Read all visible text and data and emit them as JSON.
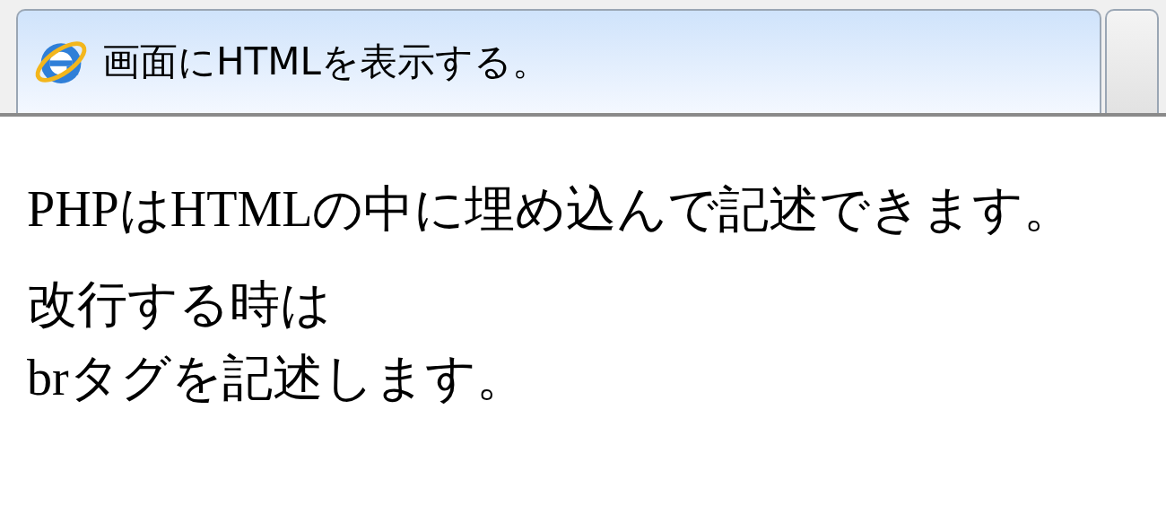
{
  "tabs": [
    {
      "title": "画面にHTMLを表示する。",
      "selected": true
    },
    {
      "selected": false
    }
  ],
  "page": {
    "paragraphs": [
      {
        "lines": [
          "PHPはHTMLの中に埋め込んで記述できます。"
        ]
      },
      {
        "lines": [
          "改行する時は",
          "brタグを記述します。"
        ]
      }
    ]
  }
}
